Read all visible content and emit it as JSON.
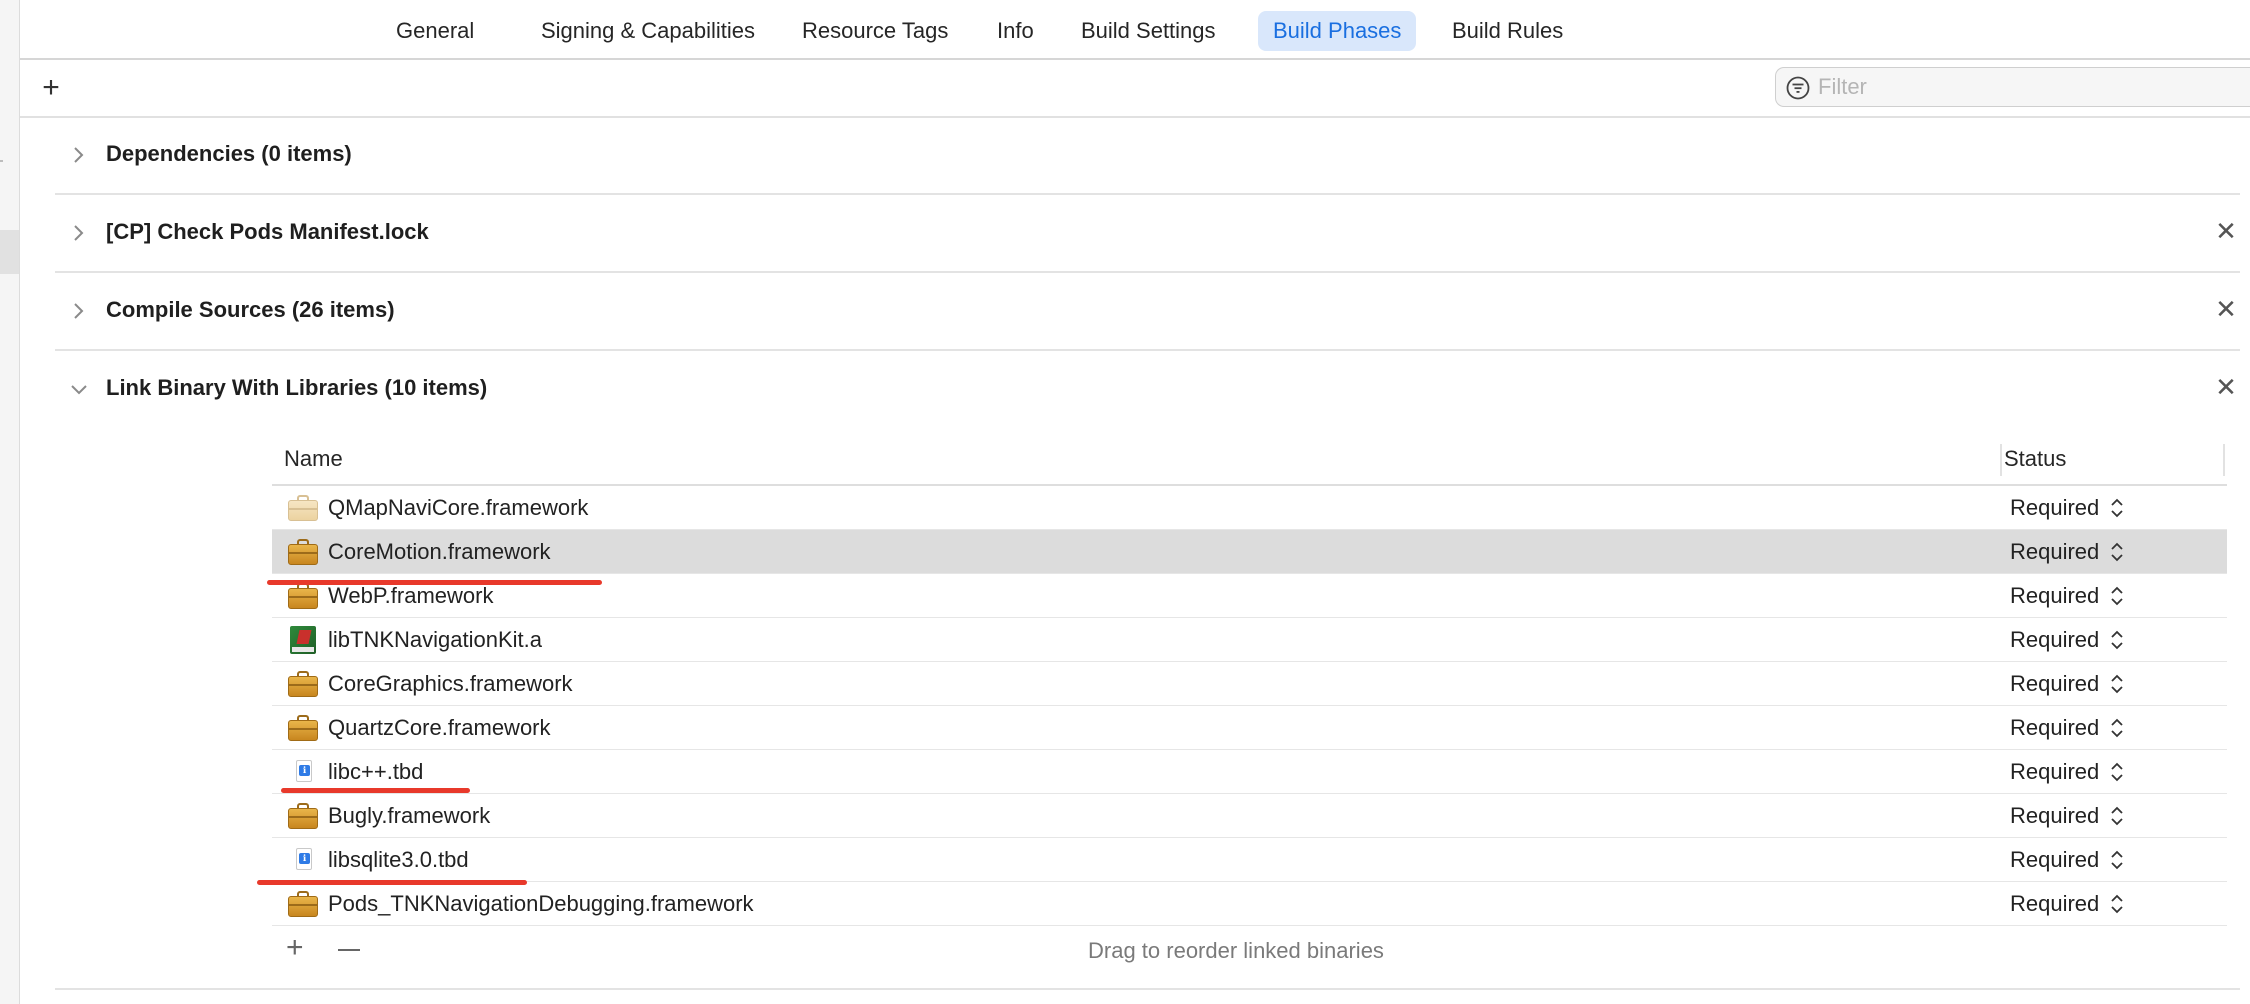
{
  "tabs": [
    {
      "label": "General",
      "active": false
    },
    {
      "label": "Signing & Capabilities",
      "active": false
    },
    {
      "label": "Resource Tags",
      "active": false
    },
    {
      "label": "Info",
      "active": false
    },
    {
      "label": "Build Settings",
      "active": false
    },
    {
      "label": "Build Phases",
      "active": true
    },
    {
      "label": "Build Rules",
      "active": false
    }
  ],
  "toolbar": {
    "add_label": "+",
    "filter_placeholder": "Filter",
    "filter_value": ""
  },
  "phases": [
    {
      "title": "Dependencies (0 items)",
      "expanded": false,
      "closable": false
    },
    {
      "title": "[CP] Check Pods Manifest.lock",
      "expanded": false,
      "closable": true
    },
    {
      "title": "Compile Sources (26 items)",
      "expanded": false,
      "closable": true
    },
    {
      "title": "Link Binary With Libraries (10 items)",
      "expanded": true,
      "closable": true
    }
  ],
  "close_glyph": "✕",
  "libraries": {
    "columns": {
      "name": "Name",
      "status": "Status"
    },
    "rows": [
      {
        "name": "QMapNaviCore.framework",
        "status": "Required",
        "icon": "framework-faded-icon",
        "selected": false
      },
      {
        "name": "CoreMotion.framework",
        "status": "Required",
        "icon": "framework-icon",
        "selected": true
      },
      {
        "name": "WebP.framework",
        "status": "Required",
        "icon": "framework-icon",
        "selected": false
      },
      {
        "name": "libTNKNavigationKit.a",
        "status": "Required",
        "icon": "static-library-icon",
        "selected": false
      },
      {
        "name": "CoreGraphics.framework",
        "status": "Required",
        "icon": "framework-icon",
        "selected": false
      },
      {
        "name": "QuartzCore.framework",
        "status": "Required",
        "icon": "framework-icon",
        "selected": false
      },
      {
        "name": "libc++.tbd",
        "status": "Required",
        "icon": "tbd-file-icon",
        "selected": false
      },
      {
        "name": "Bugly.framework",
        "status": "Required",
        "icon": "framework-icon",
        "selected": false
      },
      {
        "name": "libsqlite3.0.tbd",
        "status": "Required",
        "icon": "tbd-file-icon",
        "selected": false
      },
      {
        "name": "Pods_TNKNavigationDebugging.framework",
        "status": "Required",
        "icon": "framework-icon",
        "selected": false
      }
    ],
    "footer": {
      "add_label": "+",
      "hint": "Drag to reorder linked binaries"
    }
  },
  "colors": {
    "accent": "#1a6fe0",
    "tab_active_bg": "#d9e7fb",
    "annotation": "#e8392b",
    "selection": "#dcdcdc"
  }
}
